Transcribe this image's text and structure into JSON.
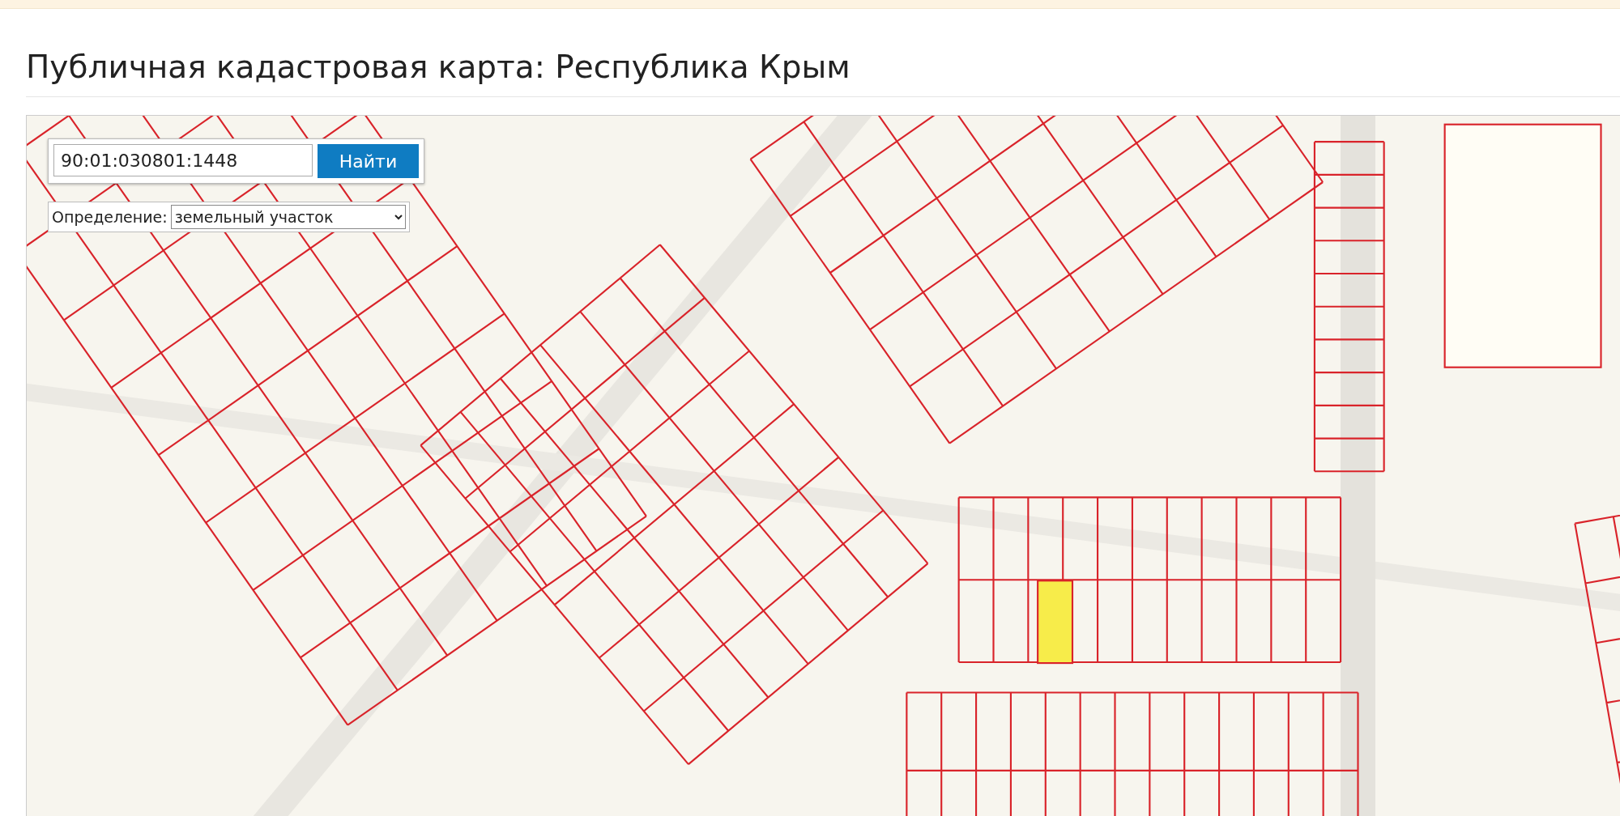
{
  "page": {
    "title": "Публичная кадастровая карта: Республика Крым"
  },
  "map": {
    "kind": "picture",
    "search": {
      "value": "90:01:030801:1448",
      "button": "Найти"
    },
    "definition": {
      "label": "Определение:",
      "value": "земельный участок"
    }
  }
}
